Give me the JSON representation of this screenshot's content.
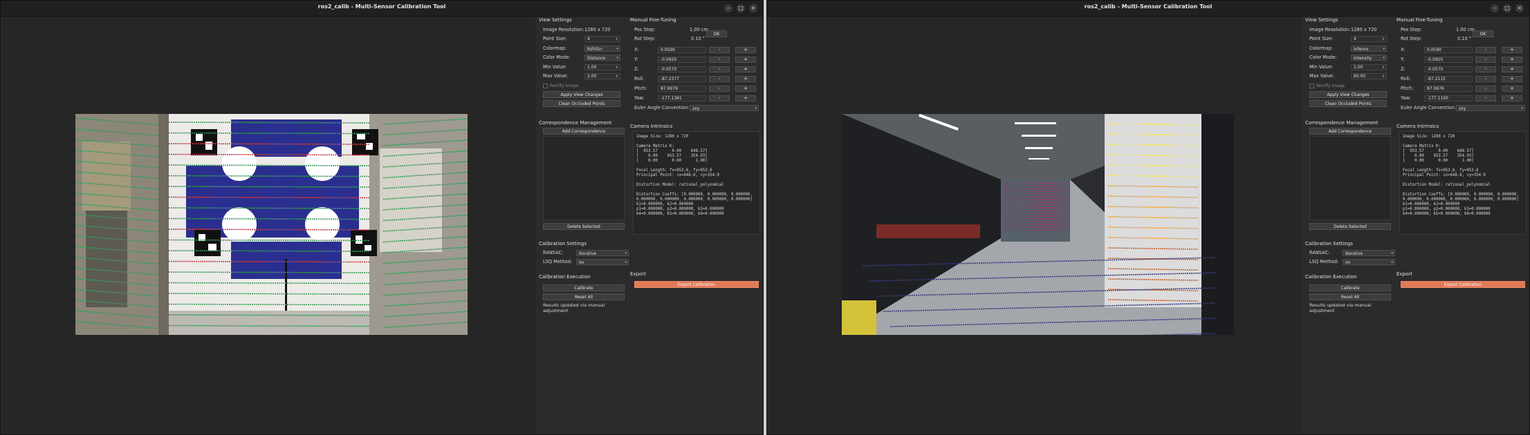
{
  "windows": [
    {
      "title": "ros2_calib - Multi-Sensor Calibration Tool",
      "scene": "target",
      "view_settings": {
        "title": "View Settings",
        "image_resolution_label": "Image Resolution:",
        "image_resolution": "1280 x 720",
        "point_size_label": "Point Size:",
        "point_size": "4",
        "colormap_label": "Colormap:",
        "colormap": "RdYlGn",
        "color_mode_label": "Color Mode:",
        "color_mode": "Distance",
        "min_value_label": "Min Value:",
        "min_value": "1.00",
        "max_value_label": "Max Value:",
        "max_value": "2.00",
        "rectify_label": "Rectify Image",
        "apply_label": "Apply View Changes",
        "clean_label": "Clean Occluded Points"
      },
      "fine_tuning": {
        "title": "Manual Fine-Tuning",
        "pos_step_label": "Pos Step:",
        "pos_step": "1.00 cm",
        "ok_label": "OK",
        "rot_step_label": "Rot Step:",
        "rot_step": "0.10 °",
        "rows": [
          {
            "label": "X:",
            "value": "0.0590"
          },
          {
            "label": "Y:",
            "value": "-0.0920"
          },
          {
            "label": "Z:",
            "value": "-0.0570"
          },
          {
            "label": "Roll:",
            "value": "-87.2377"
          },
          {
            "label": "Pitch:",
            "value": "87.9979"
          },
          {
            "label": "Yaw:",
            "value": "-177.1381"
          }
        ],
        "minus_label": "-",
        "plus_label": "+",
        "euler_label": "Euler Angle Convention:",
        "euler_value": "zxy"
      },
      "correspondence": {
        "title": "Correspondence Management",
        "add_label": "Add Correspondence",
        "delete_label": "Delete Selected"
      },
      "intrinsics": {
        "title": "Camera Intrinsics",
        "lines": [
          "Image Size: 1280 x 720",
          "",
          "Camera Matrix K:",
          "[  953.57      0.00    648.57]",
          "[    0.00    953.57    354.93]",
          "[    0.00      0.00      1.00]",
          "",
          "Focal Length: fx=953.6, fy=953.6",
          "Principal Point: cx=648.6, cy=354.9",
          "",
          "Distortion Model: rational_polynomial",
          "",
          "Distortion Coeffs: [0.000000, 0.000000, 0.000000,",
          "0.000000, 0.000000, 0.000000, 0.000000, 0.000000]",
          "k1=0.000000, k2=0.000000",
          "p1=0.000000, p2=0.000000, k3=0.000000",
          "k4=0.000000, k5=0.000000, k6=0.000000"
        ]
      },
      "calib_settings": {
        "title": "Calibration Settings",
        "ransac_label": "RANSAC:",
        "ransac": "Iterative",
        "lsq_label": "LSQ Method:",
        "lsq": "lm"
      },
      "execution": {
        "title": "Calibration Execution",
        "calibrate_label": "Calibrate",
        "reset_label": "Reset All",
        "status": "Results updated via manual adjustment"
      },
      "export": {
        "title": "Export",
        "button_label": "Export Calibration"
      }
    },
    {
      "title": "ros2_calib - Multi-Sensor Calibration Tool",
      "scene": "hallway",
      "view_settings": {
        "title": "View Settings",
        "image_resolution_label": "Image Resolution:",
        "image_resolution": "1280 x 720",
        "point_size_label": "Point Size:",
        "point_size": "4",
        "colormap_label": "Colormap:",
        "colormap": "inferno",
        "color_mode_label": "Color Mode:",
        "color_mode": "Intensity",
        "min_value_label": "Min Value:",
        "min_value": "1.00",
        "max_value_label": "Max Value:",
        "max_value": "60.00",
        "rectify_label": "Rectify Image",
        "apply_label": "Apply View Changes",
        "clean_label": "Clean Occluded Points"
      },
      "fine_tuning": {
        "title": "Manual Fine-Tuning",
        "pos_step_label": "Pos Step:",
        "pos_step": "1.00 cm",
        "ok_label": "OK",
        "rot_step_label": "Rot Step:",
        "rot_step": "0.10 °",
        "rows": [
          {
            "label": "X:",
            "value": "0.0590"
          },
          {
            "label": "Y:",
            "value": "-0.0920"
          },
          {
            "label": "Z:",
            "value": "-0.0570"
          },
          {
            "label": "Roll:",
            "value": "-87.2115"
          },
          {
            "label": "Pitch:",
            "value": "87.9976"
          },
          {
            "label": "Yaw:",
            "value": "-177.1100"
          }
        ],
        "minus_label": "-",
        "plus_label": "+",
        "euler_label": "Euler Angle Convention:",
        "euler_value": "zxy"
      },
      "correspondence": {
        "title": "Correspondence Management",
        "add_label": "Add Correspondence",
        "delete_label": "Delete Selected"
      },
      "intrinsics": {
        "title": "Camera Intrinsics",
        "lines": [
          "Image Size: 1280 x 720",
          "",
          "Camera Matrix K:",
          "[  953.57      0.00    648.57]",
          "[    0.00    953.57    354.93]",
          "[    0.00      0.00      1.00]",
          "",
          "Focal Length: fx=953.6, fy=953.6",
          "Principal Point: cx=648.6, cy=354.9",
          "",
          "Distortion Model: rational_polynomial",
          "",
          "Distortion Coeffs: [0.000000, 0.000000, 0.000000,",
          "0.000000, 0.000000, 0.000000, 0.000000, 0.000000]",
          "k1=0.000000, k2=0.000000",
          "p1=0.000000, p2=0.000000, k3=0.000000",
          "k4=0.000000, k5=0.000000, k6=0.000000"
        ]
      },
      "calib_settings": {
        "title": "Calibration Settings",
        "ransac_label": "RANSAC:",
        "ransac": "Iterative",
        "lsq_label": "LSQ Method:",
        "lsq": "lm"
      },
      "execution": {
        "title": "Calibration Execution",
        "calibrate_label": "Calibrate",
        "reset_label": "Reset All",
        "status": "Results updated via manual adjustment"
      },
      "export": {
        "title": "Export",
        "button_label": "Export Calibration"
      }
    }
  ],
  "colors": {
    "window_bg": "#2b2b2b",
    "viewer_bg": "#262626",
    "export_accent": "#e07a58",
    "target_blue": "#2a2f8f"
  },
  "icons": [
    "minimize-icon",
    "maximize-icon",
    "close-icon",
    "dropdown-arrow-icon",
    "spin-arrows-icon"
  ]
}
